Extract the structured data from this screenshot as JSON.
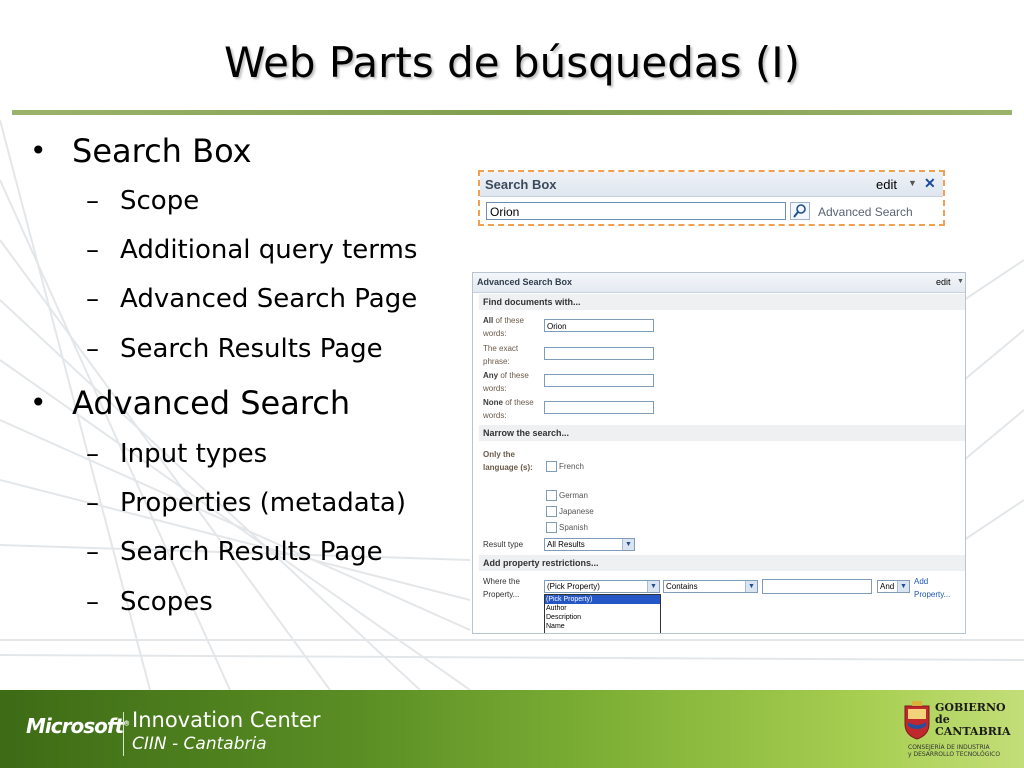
{
  "slide": {
    "title": "Web Parts de búsquedas (I)"
  },
  "bullets": [
    {
      "text": "Search Box",
      "sub": [
        "Scope",
        "Additional query terms",
        "Advanced Search Page",
        "Search Results Page"
      ]
    },
    {
      "text": "Advanced Search",
      "sub": [
        "Input types",
        "Properties (metadata)",
        "Search Results Page",
        "Scopes"
      ]
    }
  ],
  "search_box": {
    "title": "Search Box",
    "edit_label": "edit",
    "query_value": "Orion",
    "advanced_link": "Advanced Search"
  },
  "advanced_search": {
    "title": "Advanced Search Box",
    "edit_label": "edit",
    "section_find": "Find documents with...",
    "fields": [
      {
        "bold": "All",
        "rest": " of these words:",
        "value": "Orion"
      },
      {
        "bold": "",
        "rest": "The exact phrase:",
        "value": ""
      },
      {
        "bold": "Any",
        "rest": " of these words:",
        "value": ""
      },
      {
        "bold": "None",
        "rest": " of these words:",
        "value": ""
      }
    ],
    "section_narrow": "Narrow the search...",
    "language_label": "Only the language (s):",
    "languages": [
      "French",
      "German",
      "Japanese",
      "Spanish"
    ],
    "result_type_label": "Result type",
    "result_type_value": "All Results",
    "section_property": "Add property restrictions...",
    "where_label": "Where the Property...",
    "property_value": "(Pick Property)",
    "operator_value": "Contains",
    "conjunction_value": "And",
    "add_property_link": "Add Property...",
    "property_options": [
      "(Pick Property)",
      "Author",
      "Description",
      "Name"
    ]
  },
  "footer": {
    "microsoft": "Microsoft",
    "innovation_center": "Innovation Center",
    "ciin": "CIIN - Cantabria",
    "gov_line1": "GOBIERNO",
    "gov_line2": "de",
    "gov_line3": "CANTABRIA",
    "gov_sub1": "CONSEJERÍA DE INDUSTRIA",
    "gov_sub2": "y DESARROLLO TECNOLÓGICO"
  },
  "colors": {
    "title_rule": "#8aa85a",
    "footer_green": "#5a8e24",
    "web_part_dash": "#f0a050"
  }
}
